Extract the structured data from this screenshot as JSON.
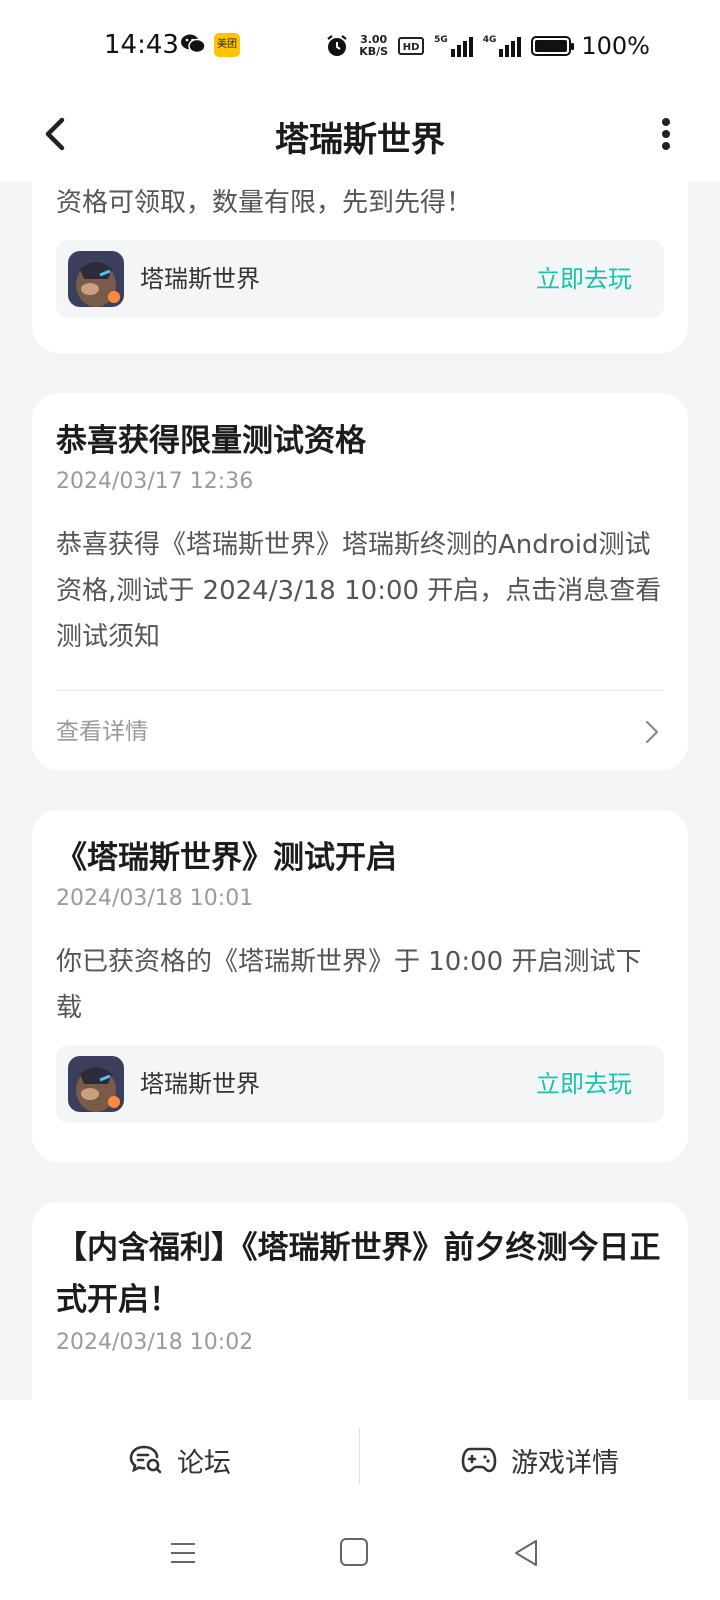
{
  "status_bar": {
    "time": "14:43",
    "meituan_label": "美团",
    "speed_value": "3.00",
    "speed_unit": "KB/S",
    "hd_label": "HD",
    "net1": "5G",
    "net2": "4G",
    "battery": "100%"
  },
  "header": {
    "title": "塔瑞斯世界",
    "back_icon": "chevron-left-icon",
    "more_icon": "more-vertical-icon"
  },
  "cards": [
    {
      "body": "资格可领取，数量有限，先到先得！",
      "game": {
        "name": "塔瑞斯世界",
        "action": "立即去玩"
      }
    },
    {
      "title": "恭喜获得限量测试资格",
      "time": "2024/03/17 12:36",
      "body": "恭喜获得《塔瑞斯世界》塔瑞斯终测的Android测试资格,测试于 2024/3/18 10:00 开启，点击消息查看测试须知",
      "detail_label": "查看详情"
    },
    {
      "title": "《塔瑞斯世界》测试开启",
      "time": "2024/03/18 10:01",
      "body": "你已获资格的《塔瑞斯世界》于 10:00 开启测试下载",
      "game": {
        "name": "塔瑞斯世界",
        "action": "立即去玩"
      }
    },
    {
      "title": "【内含福利】《塔瑞斯世界》前夕终测今日正式开启！",
      "time": "2024/03/18 10:02"
    }
  ],
  "bottom_tabs": {
    "forum": "论坛",
    "game_detail": "游戏详情"
  },
  "colors": {
    "accent": "#19c2ae",
    "background": "#f3f4f6"
  }
}
